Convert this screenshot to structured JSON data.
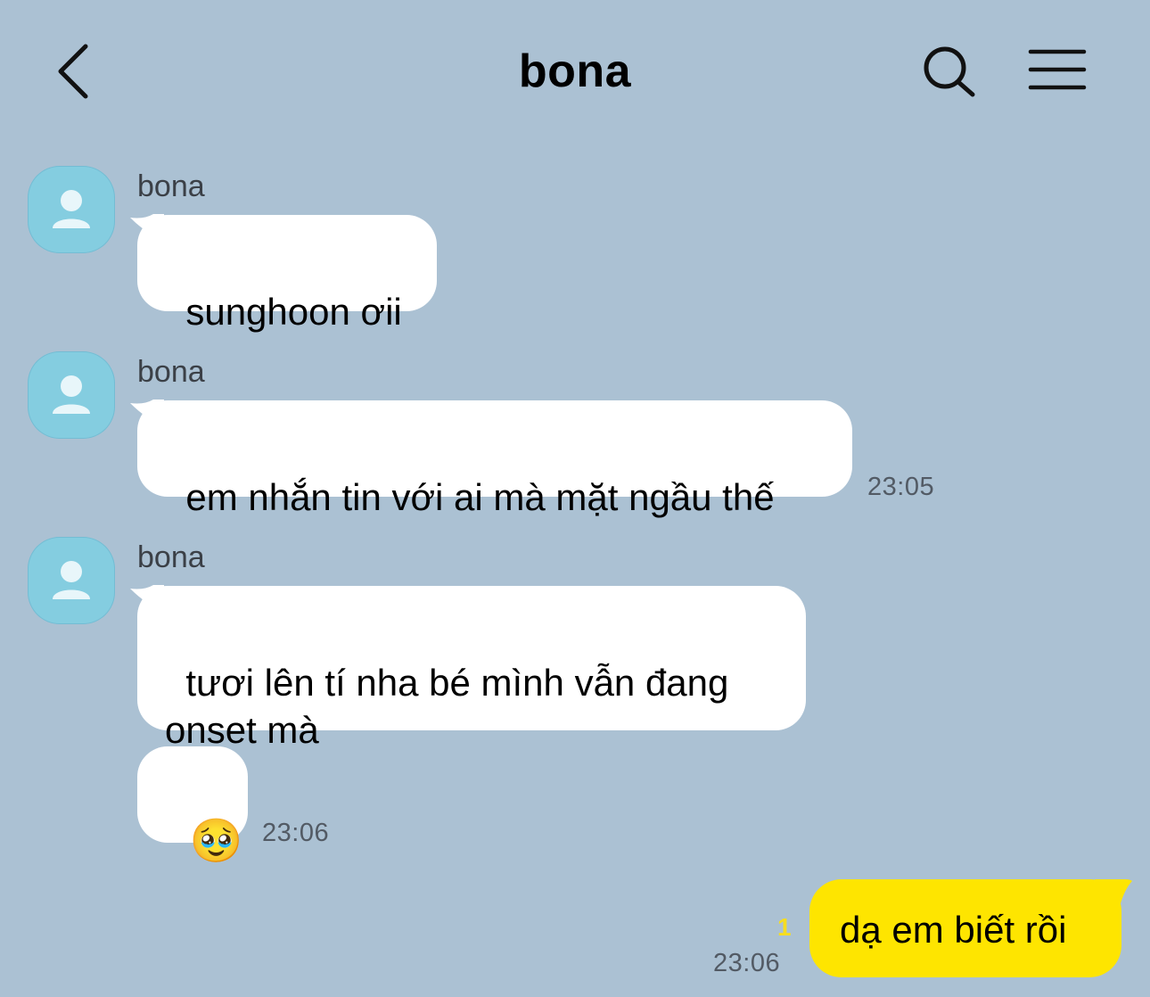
{
  "header": {
    "title": "bona",
    "back_icon": "chevron-left-icon",
    "search_icon": "search-icon",
    "menu_icon": "hamburger-menu-icon"
  },
  "messages": [
    {
      "sender": "bona",
      "text": "sunghoon ơii",
      "time": ""
    },
    {
      "sender": "bona",
      "text": "em nhắn tin với ai mà mặt ngầu thế",
      "time": "23:05"
    },
    {
      "sender": "bona",
      "text": "tươi lên tí nha bé mình vẫn đang\nonset mà",
      "time": ""
    },
    {
      "sender": "",
      "text": "🥹",
      "time": "23:06"
    }
  ],
  "my_message": {
    "text": "dạ em biết rồi",
    "time": "23:06",
    "unread_count": "1"
  },
  "colors": {
    "background": "#abc1d3",
    "incoming_bubble": "#ffffff",
    "outgoing_bubble": "#fee500",
    "avatar": "#84cde0",
    "unread": "#f6dd20"
  }
}
